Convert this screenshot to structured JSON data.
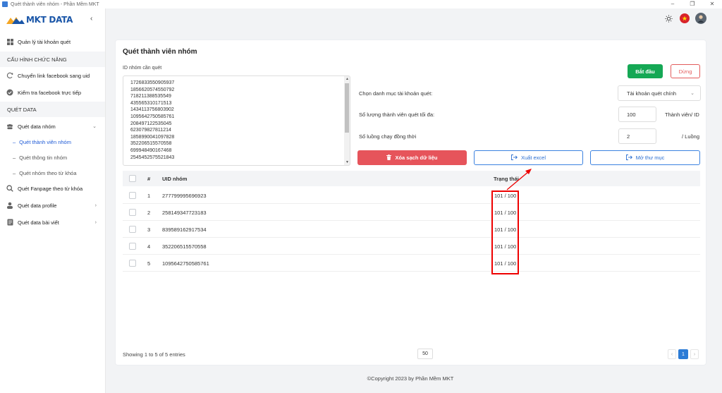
{
  "window": {
    "title": "Quét thành viên nhóm - Phần Mềm MKT",
    "controls": [
      "–",
      "❐",
      "✕"
    ]
  },
  "brand": {
    "name": "MKT DATA"
  },
  "sidebar": {
    "collapse_icon": "‹",
    "items": [
      {
        "label": "Quản lý tài khoản quét",
        "icon": "grid-icon"
      }
    ],
    "section_config": "CẤU HÌNH CHỨC NĂNG",
    "config_items": [
      {
        "label": "Chuyển link facebook sang uid",
        "icon": "sync-icon"
      },
      {
        "label": "Kiểm tra facebook trực tiếp",
        "icon": "check-circle-icon"
      }
    ],
    "section_data": "QUÉT DATA",
    "group_label": "Quét data nhóm",
    "group_subitems": [
      {
        "label": "Quét thành viên nhóm",
        "active": true
      },
      {
        "label": "Quét thông tin nhóm",
        "active": false
      },
      {
        "label": "Quét nhóm theo từ khóa",
        "active": false
      }
    ],
    "bottom_items": [
      {
        "label": "Quét Fanpage theo từ khóa",
        "icon": "search-icon",
        "has_chevron": false
      },
      {
        "label": "Quét data profile",
        "icon": "profile-icon",
        "has_chevron": true
      },
      {
        "label": "Quét data bài viết",
        "icon": "document-icon",
        "has_chevron": true
      }
    ]
  },
  "page": {
    "title": "Quét thành viên nhóm",
    "id_label": "ID nhóm cần quét",
    "id_list": [
      "1726833550905937",
      "1856620574550792",
      "718211388535549",
      "435565310171513",
      "1434113756803902",
      "1095642750585761",
      "208497122535045",
      "623079827811214",
      "1858990041097828",
      "352206515570558",
      "699948490167468",
      "2545452575521843"
    ],
    "start_button": "Bắt đầu",
    "stop_button": "Dừng",
    "account_category_label": "Chọn danh mục tài khoản quét:",
    "account_category_value": "Tài khoản quét chính",
    "max_members_label": "Số lượng thành viên quét tối đa:",
    "max_members_value": "100",
    "max_members_unit": "Thành viên/ ID",
    "threads_label": "Số luồng chạy đồng thời",
    "threads_value": "2",
    "threads_unit": "/ Luồng",
    "clear_button": "Xóa sạch dữ liệu",
    "export_button": "Xuất excel",
    "folder_button": "Mở thư mục"
  },
  "table": {
    "headers": {
      "index": "#",
      "uid": "UID nhóm",
      "status": "Trạng thái"
    },
    "rows": [
      {
        "index": "1",
        "uid": "277799995696923",
        "status": "101 / 100"
      },
      {
        "index": "2",
        "uid": "258149347723183",
        "status": "101 / 100"
      },
      {
        "index": "3",
        "uid": "839589162917534",
        "status": "101 / 100"
      },
      {
        "index": "4",
        "uid": "352206515570558",
        "status": "101 / 100"
      },
      {
        "index": "5",
        "uid": "1095642750585761",
        "status": "101 / 100"
      }
    ],
    "info": "Showing 1 to 5 of 5 entries",
    "page_size": "50",
    "prev": "‹",
    "current_page": "1",
    "next": "›"
  },
  "footer": {
    "copyright": "©Copyright 2023 by Phần Mềm MKT"
  },
  "colors": {
    "brand": "#1a56a8",
    "start": "#15a855",
    "danger": "#e6545b",
    "primary": "#2b7bd6",
    "annotation": "#ee0000"
  }
}
